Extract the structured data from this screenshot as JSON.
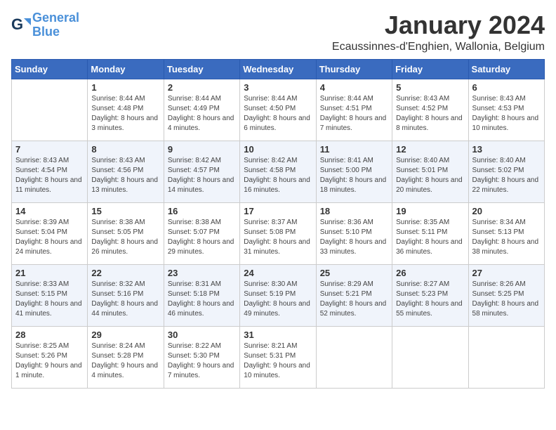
{
  "logo": {
    "line1": "General",
    "line2": "Blue"
  },
  "title": "January 2024",
  "location": "Ecaussinnes-d'Enghien, Wallonia, Belgium",
  "days_of_week": [
    "Sunday",
    "Monday",
    "Tuesday",
    "Wednesday",
    "Thursday",
    "Friday",
    "Saturday"
  ],
  "weeks": [
    [
      {
        "day": "",
        "sunrise": "",
        "sunset": "",
        "daylight": ""
      },
      {
        "day": "1",
        "sunrise": "8:44 AM",
        "sunset": "4:48 PM",
        "daylight": "8 hours and 3 minutes."
      },
      {
        "day": "2",
        "sunrise": "8:44 AM",
        "sunset": "4:49 PM",
        "daylight": "8 hours and 4 minutes."
      },
      {
        "day": "3",
        "sunrise": "8:44 AM",
        "sunset": "4:50 PM",
        "daylight": "8 hours and 6 minutes."
      },
      {
        "day": "4",
        "sunrise": "8:44 AM",
        "sunset": "4:51 PM",
        "daylight": "8 hours and 7 minutes."
      },
      {
        "day": "5",
        "sunrise": "8:43 AM",
        "sunset": "4:52 PM",
        "daylight": "8 hours and 8 minutes."
      },
      {
        "day": "6",
        "sunrise": "8:43 AM",
        "sunset": "4:53 PM",
        "daylight": "8 hours and 10 minutes."
      }
    ],
    [
      {
        "day": "7",
        "sunrise": "8:43 AM",
        "sunset": "4:54 PM",
        "daylight": "8 hours and 11 minutes."
      },
      {
        "day": "8",
        "sunrise": "8:43 AM",
        "sunset": "4:56 PM",
        "daylight": "8 hours and 13 minutes."
      },
      {
        "day": "9",
        "sunrise": "8:42 AM",
        "sunset": "4:57 PM",
        "daylight": "8 hours and 14 minutes."
      },
      {
        "day": "10",
        "sunrise": "8:42 AM",
        "sunset": "4:58 PM",
        "daylight": "8 hours and 16 minutes."
      },
      {
        "day": "11",
        "sunrise": "8:41 AM",
        "sunset": "5:00 PM",
        "daylight": "8 hours and 18 minutes."
      },
      {
        "day": "12",
        "sunrise": "8:40 AM",
        "sunset": "5:01 PM",
        "daylight": "8 hours and 20 minutes."
      },
      {
        "day": "13",
        "sunrise": "8:40 AM",
        "sunset": "5:02 PM",
        "daylight": "8 hours and 22 minutes."
      }
    ],
    [
      {
        "day": "14",
        "sunrise": "8:39 AM",
        "sunset": "5:04 PM",
        "daylight": "8 hours and 24 minutes."
      },
      {
        "day": "15",
        "sunrise": "8:38 AM",
        "sunset": "5:05 PM",
        "daylight": "8 hours and 26 minutes."
      },
      {
        "day": "16",
        "sunrise": "8:38 AM",
        "sunset": "5:07 PM",
        "daylight": "8 hours and 29 minutes."
      },
      {
        "day": "17",
        "sunrise": "8:37 AM",
        "sunset": "5:08 PM",
        "daylight": "8 hours and 31 minutes."
      },
      {
        "day": "18",
        "sunrise": "8:36 AM",
        "sunset": "5:10 PM",
        "daylight": "8 hours and 33 minutes."
      },
      {
        "day": "19",
        "sunrise": "8:35 AM",
        "sunset": "5:11 PM",
        "daylight": "8 hours and 36 minutes."
      },
      {
        "day": "20",
        "sunrise": "8:34 AM",
        "sunset": "5:13 PM",
        "daylight": "8 hours and 38 minutes."
      }
    ],
    [
      {
        "day": "21",
        "sunrise": "8:33 AM",
        "sunset": "5:15 PM",
        "daylight": "8 hours and 41 minutes."
      },
      {
        "day": "22",
        "sunrise": "8:32 AM",
        "sunset": "5:16 PM",
        "daylight": "8 hours and 44 minutes."
      },
      {
        "day": "23",
        "sunrise": "8:31 AM",
        "sunset": "5:18 PM",
        "daylight": "8 hours and 46 minutes."
      },
      {
        "day": "24",
        "sunrise": "8:30 AM",
        "sunset": "5:19 PM",
        "daylight": "8 hours and 49 minutes."
      },
      {
        "day": "25",
        "sunrise": "8:29 AM",
        "sunset": "5:21 PM",
        "daylight": "8 hours and 52 minutes."
      },
      {
        "day": "26",
        "sunrise": "8:27 AM",
        "sunset": "5:23 PM",
        "daylight": "8 hours and 55 minutes."
      },
      {
        "day": "27",
        "sunrise": "8:26 AM",
        "sunset": "5:25 PM",
        "daylight": "8 hours and 58 minutes."
      }
    ],
    [
      {
        "day": "28",
        "sunrise": "8:25 AM",
        "sunset": "5:26 PM",
        "daylight": "9 hours and 1 minute."
      },
      {
        "day": "29",
        "sunrise": "8:24 AM",
        "sunset": "5:28 PM",
        "daylight": "9 hours and 4 minutes."
      },
      {
        "day": "30",
        "sunrise": "8:22 AM",
        "sunset": "5:30 PM",
        "daylight": "9 hours and 7 minutes."
      },
      {
        "day": "31",
        "sunrise": "8:21 AM",
        "sunset": "5:31 PM",
        "daylight": "9 hours and 10 minutes."
      },
      {
        "day": "",
        "sunrise": "",
        "sunset": "",
        "daylight": ""
      },
      {
        "day": "",
        "sunrise": "",
        "sunset": "",
        "daylight": ""
      },
      {
        "day": "",
        "sunrise": "",
        "sunset": "",
        "daylight": ""
      }
    ]
  ]
}
